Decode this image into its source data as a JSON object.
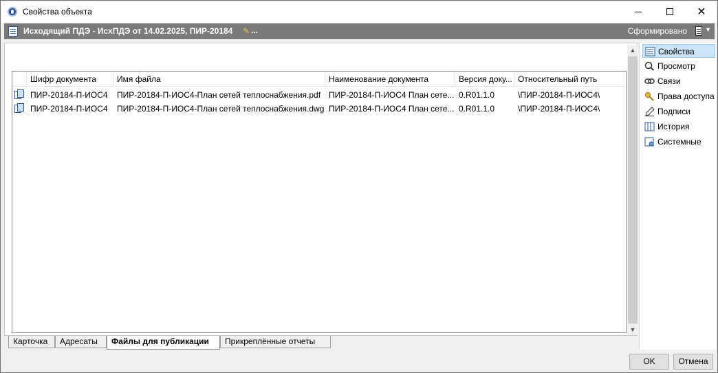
{
  "window": {
    "title": "Свойства объекта"
  },
  "header": {
    "title": "Исходящий ПДЭ - ИсхПДЭ от 14.02.2025, ПИР-20184",
    "dots": "...",
    "status": "Сформировано"
  },
  "grid": {
    "columns": [
      "Шифр документа",
      "Имя файла",
      "Наименование документа",
      "Версия доку...",
      "Относительный путь"
    ],
    "rows": [
      [
        "ПИР-20184-П-ИОС4",
        "ПИР-20184-П-ИОС4-План сетей теплоснабжения.pdf",
        "ПИР-20184-П-ИОС4 План сете...",
        "0.R01.1.0",
        "\\ПИР-20184-П-ИОС4\\"
      ],
      [
        "ПИР-20184-П-ИОС4",
        "ПИР-20184-П-ИОС4-План сетей теплоснабжения.dwg",
        "ПИР-20184-П-ИОС4 План сете...",
        "0.R01.1.0",
        "\\ПИР-20184-П-ИОС4\\"
      ]
    ]
  },
  "tabs": [
    "Карточка",
    "Адресаты",
    "Файлы для публикации",
    "Прикреплённые отчеты"
  ],
  "active_tab": "Файлы для публикации",
  "nav": [
    {
      "label": "Свойства",
      "icon": "properties-icon",
      "selected": true
    },
    {
      "label": "Просмотр",
      "icon": "magnifier-icon"
    },
    {
      "label": "Связи",
      "icon": "link-icon"
    },
    {
      "label": "Права доступа",
      "icon": "key-icon"
    },
    {
      "label": "Подписи",
      "icon": "pen-icon"
    },
    {
      "label": "История",
      "icon": "history-icon"
    },
    {
      "label": "Системные",
      "icon": "system-icon"
    }
  ],
  "buttons": {
    "ok": "OK",
    "cancel": "Отмена"
  },
  "colors": {
    "header_bg": "#7a7a7a",
    "selection": "#cce4f7"
  }
}
